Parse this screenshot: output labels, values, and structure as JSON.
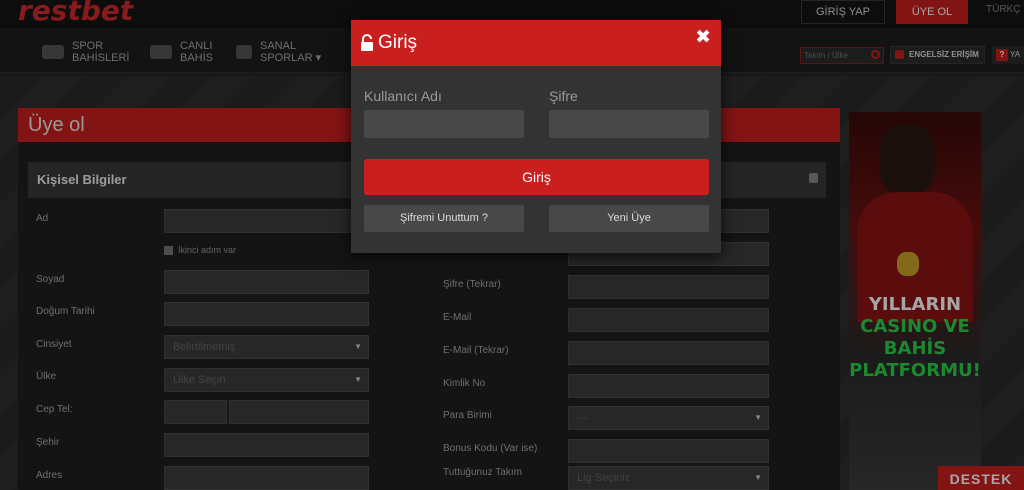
{
  "brand": {
    "logo_text": "restbet"
  },
  "topbar": {
    "login_label": "GİRİŞ YAP",
    "signup_label": "ÜYE OL",
    "lang_label": "TÜRKÇ"
  },
  "nav": {
    "items": [
      {
        "line1": "SPOR",
        "line2": "BAHİSLERİ"
      },
      {
        "line1": "CANLI",
        "line2": "BAHİS"
      },
      {
        "line1": "SANAL",
        "line2": "SPORLAR ▾"
      }
    ],
    "search_placeholder": "Takım / Ülke",
    "accessibility_label": "ENGELSİZ ERİŞİM",
    "help_label": "YA"
  },
  "page": {
    "title": "Üye ol"
  },
  "form": {
    "section_title": "Kişisel Bilgiler",
    "second_name_checkbox": "İkinci adım var",
    "left_labels": [
      "Ad",
      "Soyad",
      "Doğum Tarihi",
      "Cinsiyet",
      "Ülke",
      "Cep Tel:",
      "Şehir",
      "Adres"
    ],
    "gender_select": "Belirtilmemiş",
    "country_select": "Ülke Seçin",
    "right_labels": [
      "Şifre (Tekrar)",
      "E-Mail",
      "E-Mail (Tekrar)",
      "Kimlik No",
      "Para Birimi",
      "Bonus Kodu (Var ise)",
      "Tuttuğunuz Takım"
    ],
    "currency_select": "---",
    "team_select": "Lig Seçiniz"
  },
  "banner": {
    "line1": "YILLARIN",
    "line2": "CASINO VE",
    "line3": "BAHİS",
    "line4": "PLATFORMU!"
  },
  "support": {
    "label": "DESTEK"
  },
  "modal": {
    "title": "Giriş",
    "username_label": "Kullanıcı Adı",
    "password_label": "Şifre",
    "submit_label": "Giriş",
    "forgot_label": "Şifremi Unuttum ?",
    "new_member_label": "Yeni Üye"
  }
}
